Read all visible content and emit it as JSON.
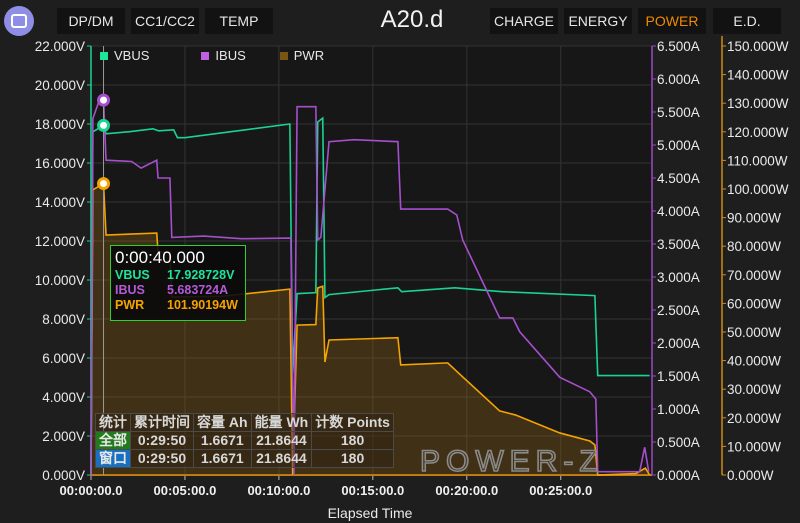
{
  "header": {
    "app_icon": "meter-screen-icon",
    "left_buttons": [
      "DP/DM",
      "CC1/CC2",
      "TEMP"
    ],
    "title": "A20.d",
    "right_buttons": [
      "CHARGE",
      "ENERGY",
      "POWER",
      "E.D."
    ],
    "active_button": "POWER",
    "active_color": "#f08a00"
  },
  "watermark": "POWER-Z",
  "tooltip": {
    "time": "0:00:40.000",
    "rows": [
      {
        "label": "VBUS",
        "value": "17.928728V",
        "color": "#1ee39a"
      },
      {
        "label": "IBUS",
        "value": "5.683724A",
        "color": "#b35ad8"
      },
      {
        "label": "PWR",
        "value": "101.90194W",
        "color": "#f5a300"
      }
    ]
  },
  "stats": {
    "headers": [
      "统计",
      "累计时间",
      "容量 Ah",
      "能量 Wh",
      "计数 Points"
    ],
    "rows": [
      [
        "全部",
        "0:29:50",
        "1.6671",
        "21.8644",
        "180"
      ],
      [
        "窗口",
        "0:29:50",
        "1.6671",
        "21.8644",
        "180"
      ]
    ]
  },
  "chart_data": {
    "type": "line",
    "xlabel": "Elapsed Time",
    "xlim": [
      "00:00:00",
      "00:29:45"
    ],
    "x_ticks": [
      "00:00:00.0",
      "00:05:00.0",
      "00:10:00.0",
      "00:15:00.0",
      "00:20:00.0",
      "00:25:00.0"
    ],
    "grid": true,
    "legend_position": "top-left",
    "cursor_time": "00:00:40",
    "axes": {
      "VBUS": {
        "ylim": [
          0,
          22
        ],
        "ticks": [
          "0.000V",
          "2.000V",
          "4.000V",
          "6.000V",
          "8.000V",
          "10.000V",
          "12.000V",
          "14.000V",
          "16.000V",
          "18.000V",
          "20.000V",
          "22.000V"
        ],
        "position": "left"
      },
      "IBUS": {
        "ylim": [
          0,
          6.5
        ],
        "ticks": [
          "0.000A",
          "0.500A",
          "1.000A",
          "1.500A",
          "2.000A",
          "2.500A",
          "3.000A",
          "3.500A",
          "4.000A",
          "4.500A",
          "5.000A",
          "5.500A",
          "6.000A",
          "6.500A"
        ],
        "position": "right"
      },
      "PWR": {
        "ylim": [
          0,
          150
        ],
        "ticks": [
          "0.000W",
          "10.000W",
          "20.000W",
          "30.000W",
          "40.000W",
          "50.000W",
          "60.000W",
          "70.000W",
          "80.000W",
          "90.000W",
          "100.000W",
          "110.000W",
          "120.000W",
          "130.000W",
          "140.000W",
          "150.000W"
        ],
        "position": "right-outer"
      }
    },
    "series": [
      {
        "name": "VBUS",
        "axis": "VBUS",
        "color": "#1ad392",
        "fill": false,
        "points": [
          [
            "00:00:00",
            0
          ],
          [
            "00:00:06",
            17.6
          ],
          [
            "00:00:40",
            17.93
          ],
          [
            "00:00:48",
            17.5
          ],
          [
            "00:02:00",
            17.6
          ],
          [
            "00:03:18",
            17.75
          ],
          [
            "00:03:36",
            17.65
          ],
          [
            "00:04:24",
            17.7
          ],
          [
            "00:04:36",
            17.3
          ],
          [
            "00:05:00",
            17.3
          ],
          [
            "00:10:35",
            18.0
          ],
          [
            "00:10:44",
            5.2
          ],
          [
            "00:10:58",
            9.3
          ],
          [
            "00:11:58",
            9.35
          ],
          [
            "00:12:04",
            18.1
          ],
          [
            "00:12:20",
            18.3
          ],
          [
            "00:12:27",
            9.1
          ],
          [
            "00:12:40",
            9.25
          ],
          [
            "00:16:20",
            9.6
          ],
          [
            "00:16:32",
            9.4
          ],
          [
            "00:19:22",
            9.6
          ],
          [
            "00:21:52",
            9.4
          ],
          [
            "00:26:49",
            9.2
          ],
          [
            "00:26:58",
            5.1
          ],
          [
            "00:29:44",
            5.1
          ]
        ]
      },
      {
        "name": "IBUS",
        "axis": "IBUS",
        "color": "#a64fcc",
        "fill": false,
        "points": [
          [
            "00:00:00",
            0
          ],
          [
            "00:00:06",
            5.4
          ],
          [
            "00:00:26",
            5.67
          ],
          [
            "00:00:40",
            5.68
          ],
          [
            "00:00:48",
            4.77
          ],
          [
            "00:02:10",
            4.75
          ],
          [
            "00:02:40",
            4.65
          ],
          [
            "00:03:30",
            4.77
          ],
          [
            "00:03:34",
            4.5
          ],
          [
            "00:04:12",
            4.5
          ],
          [
            "00:04:18",
            3.6
          ],
          [
            "00:06:00",
            3.62
          ],
          [
            "00:08:00",
            3.58
          ],
          [
            "00:10:38",
            3.59
          ],
          [
            "00:10:48",
            0
          ],
          [
            "00:10:58",
            5.58
          ],
          [
            "00:11:58",
            5.58
          ],
          [
            "00:12:04",
            3.56
          ],
          [
            "00:12:14",
            3.6
          ],
          [
            "00:12:40",
            5.05
          ],
          [
            "00:14:00",
            5.08
          ],
          [
            "00:16:20",
            5.05
          ],
          [
            "00:16:29",
            4.03
          ],
          [
            "00:18:59",
            4.03
          ],
          [
            "00:19:28",
            3.94
          ],
          [
            "00:19:47",
            3.56
          ],
          [
            "00:21:45",
            2.38
          ],
          [
            "00:22:27",
            2.38
          ],
          [
            "00:22:49",
            2.17
          ],
          [
            "00:24:57",
            1.48
          ],
          [
            "00:26:33",
            1.26
          ],
          [
            "00:26:52",
            1.15
          ],
          [
            "00:26:58",
            0.05
          ],
          [
            "00:29:12",
            0.05
          ],
          [
            "00:29:28",
            0.42
          ],
          [
            "00:29:41",
            0.05
          ]
        ]
      },
      {
        "name": "PWR",
        "axis": "PWR",
        "color": "#f5a300",
        "fill": true,
        "points": [
          [
            "00:00:00",
            0
          ],
          [
            "00:00:06",
            99.7
          ],
          [
            "00:00:40",
            101.9
          ],
          [
            "00:00:48",
            83.9
          ],
          [
            "00:03:30",
            84.6
          ],
          [
            "00:03:34",
            78.0
          ],
          [
            "00:04:12",
            78.0
          ],
          [
            "00:04:18",
            62.2
          ],
          [
            "00:07:00",
            62.5
          ],
          [
            "00:10:35",
            65.0
          ],
          [
            "00:10:44",
            0
          ],
          [
            "00:10:58",
            52.4
          ],
          [
            "00:11:58",
            52.6
          ],
          [
            "00:12:04",
            65.4
          ],
          [
            "00:12:20",
            66.0
          ],
          [
            "00:12:27",
            39.5
          ],
          [
            "00:12:40",
            47.2
          ],
          [
            "00:16:20",
            48.0
          ],
          [
            "00:16:29",
            38.5
          ],
          [
            "00:18:59",
            39.2
          ],
          [
            "00:19:47",
            34.3
          ],
          [
            "00:21:45",
            22.4
          ],
          [
            "00:22:35",
            21.0
          ],
          [
            "00:24:57",
            14.7
          ],
          [
            "00:26:33",
            11.9
          ],
          [
            "00:26:49",
            10.5
          ],
          [
            "00:26:58",
            0
          ],
          [
            "00:29:00",
            0.5
          ],
          [
            "00:29:30",
            2.4
          ],
          [
            "00:29:44",
            0
          ]
        ]
      }
    ]
  }
}
